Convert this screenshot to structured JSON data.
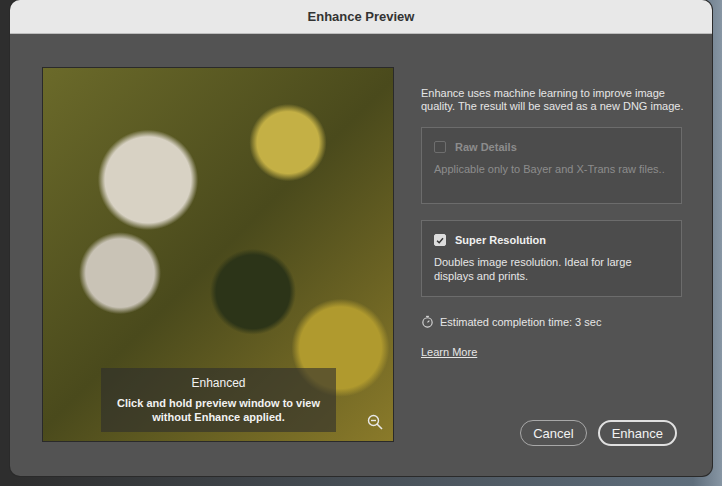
{
  "window": {
    "title": "Enhance Preview"
  },
  "preview": {
    "overlay_title": "Enhanced",
    "overlay_hint": "Click and hold preview window to view without Enhance applied."
  },
  "description": "Enhance uses machine learning to improve image quality. The result will be saved as a new DNG image.",
  "options": [
    {
      "label": "Raw Details",
      "description": "Applicable only to Bayer and X-Trans raw files..",
      "checked": false,
      "disabled": true
    },
    {
      "label": "Super Resolution",
      "description": "Doubles image resolution. Ideal for large displays and prints.",
      "checked": true,
      "disabled": false
    }
  ],
  "estimate": "Estimated completion time: 3 sec",
  "link": "Learn More",
  "buttons": [
    {
      "label": "Cancel",
      "default": false
    },
    {
      "label": "Enhance",
      "default": true
    }
  ]
}
